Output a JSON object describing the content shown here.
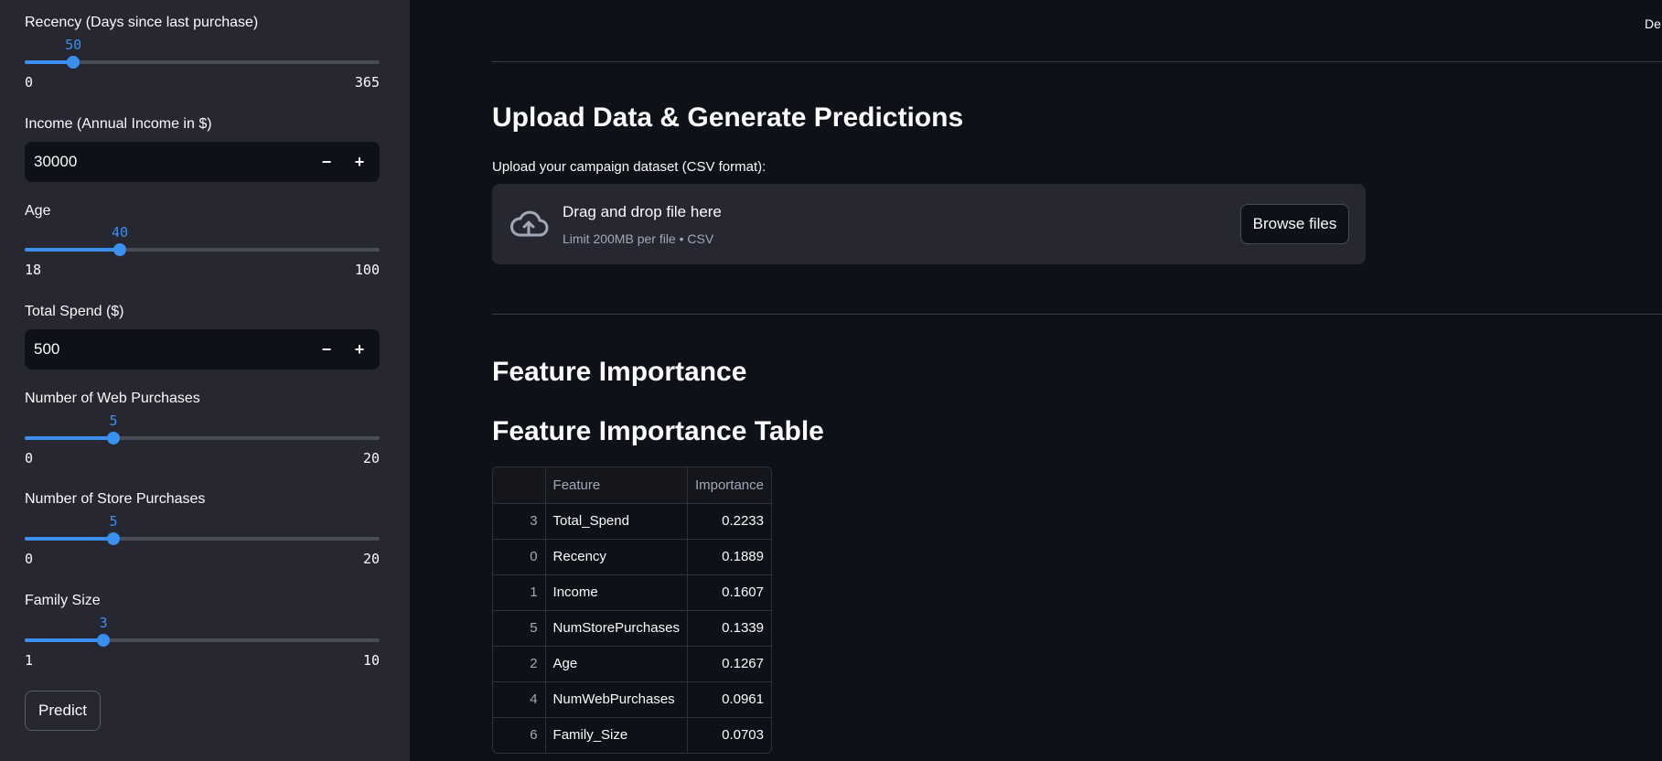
{
  "sidebar": {
    "recency": {
      "label": "Recency (Days since last purchase)",
      "value": "50",
      "min": "0",
      "max": "365",
      "fraction": 0.137
    },
    "income": {
      "label": "Income (Annual Income in $)",
      "value": "30000",
      "minus": "−",
      "plus": "+"
    },
    "age": {
      "label": "Age",
      "value": "40",
      "min": "18",
      "max": "100",
      "fraction": 0.268
    },
    "total_spend": {
      "label": "Total Spend ($)",
      "value": "500",
      "minus": "−",
      "plus": "+"
    },
    "web_purchases": {
      "label": "Number of Web Purchases",
      "value": "5",
      "min": "0",
      "max": "20",
      "fraction": 0.25
    },
    "store_purchases": {
      "label": "Number of Store Purchases",
      "value": "5",
      "min": "0",
      "max": "20",
      "fraction": 0.25
    },
    "family_size": {
      "label": "Family Size",
      "value": "3",
      "min": "1",
      "max": "10",
      "fraction": 0.222
    },
    "predict_label": "Predict"
  },
  "main": {
    "top_right_text": "De",
    "upload_title": "Upload Data & Generate Predictions",
    "upload_label": "Upload your campaign dataset (CSV format):",
    "dropzone_title": "Drag and drop file here",
    "dropzone_subtitle": "Limit 200MB per file • CSV",
    "browse_label": "Browse files",
    "feature_importance_title": "Feature Importance",
    "table_title": "Feature Importance Table",
    "table": {
      "headers": [
        "",
        "Feature",
        "Importance"
      ],
      "rows": [
        [
          "3",
          "Total_Spend",
          "0.2233"
        ],
        [
          "0",
          "Recency",
          "0.1889"
        ],
        [
          "1",
          "Income",
          "0.1607"
        ],
        [
          "5",
          "NumStorePurchases",
          "0.1339"
        ],
        [
          "2",
          "Age",
          "0.1267"
        ],
        [
          "4",
          "NumWebPurchases",
          "0.0961"
        ],
        [
          "6",
          "Family_Size",
          "0.0703"
        ]
      ]
    }
  },
  "colors": {
    "accent": "#3a8fef",
    "sidebar_bg": "#262730",
    "main_bg": "#0e1117"
  },
  "icons": {
    "upload": "cloud-upload-icon"
  }
}
